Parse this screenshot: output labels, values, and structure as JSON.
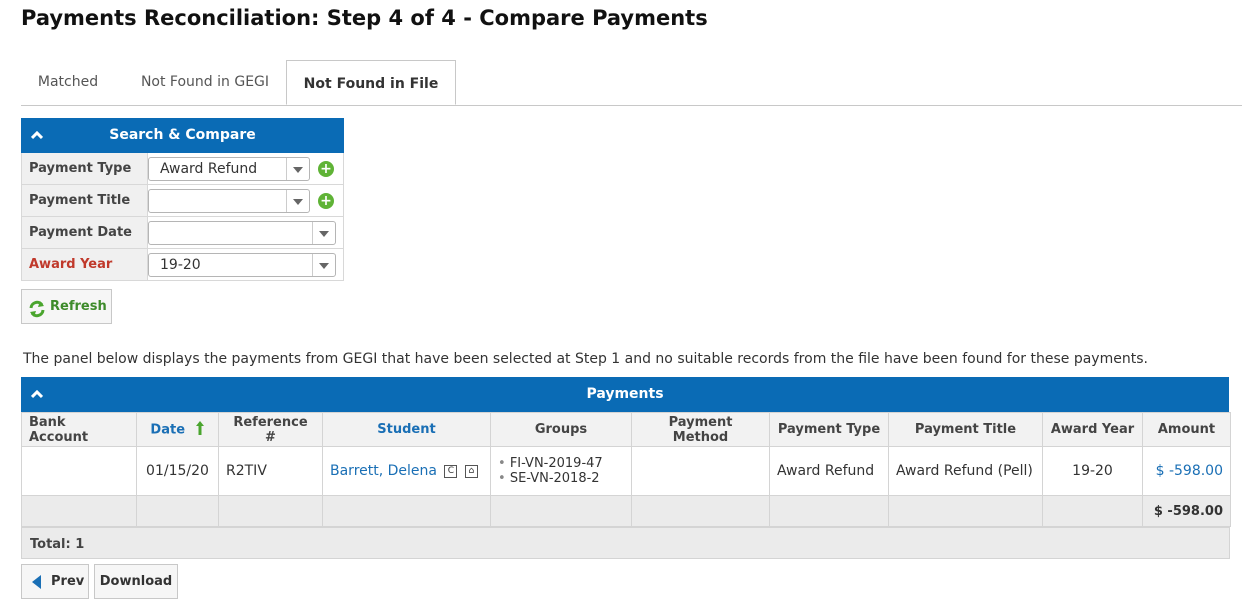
{
  "page": {
    "title": "Payments Reconciliation: Step 4 of 4 - Compare Payments"
  },
  "tabs": [
    {
      "label": "Matched",
      "active": false
    },
    {
      "label": "Not Found in GEGI",
      "active": false
    },
    {
      "label": "Not Found in File",
      "active": true
    }
  ],
  "search": {
    "title": "Search & Compare",
    "fields": [
      {
        "label": "Payment Type",
        "value": "Award Refund",
        "required": false,
        "has_add": true
      },
      {
        "label": "Payment Title",
        "value": "",
        "required": false,
        "has_add": true
      },
      {
        "label": "Payment Date",
        "value": "",
        "required": false,
        "has_add": false
      },
      {
        "label": "Award Year",
        "value": "19-20",
        "required": true,
        "has_add": false
      }
    ],
    "refresh_label": "Refresh"
  },
  "description": "The panel below displays the payments from GEGI that have been selected at Step 1 and no suitable records from the file have been found for these payments.",
  "payments": {
    "title": "Payments",
    "columns": [
      "Bank Account",
      "Date",
      "Reference #",
      "Student",
      "Groups",
      "Payment Method",
      "Payment Type",
      "Payment Title",
      "Award Year",
      "Amount"
    ],
    "rows": [
      {
        "bank_account": "",
        "date": "01/15/20",
        "reference": "R2TIV",
        "student": "Barrett, Delena",
        "groups": [
          "FI-VN-2019-47",
          "SE-VN-2018-2"
        ],
        "payment_method": "",
        "payment_type": "Award Refund",
        "payment_title": "Award Refund (Pell)",
        "award_year": "19-20",
        "amount": "$ -598.00"
      }
    ],
    "sum_amount": "$ -598.00",
    "total_label": "Total: 1"
  },
  "footer": {
    "prev_label": "Prev",
    "download_label": "Download"
  },
  "colors": {
    "header_blue": "#0a6bb5",
    "link_blue": "#1a6fb5",
    "required_red": "#c0392b",
    "refresh_green": "#3d8b2a"
  }
}
